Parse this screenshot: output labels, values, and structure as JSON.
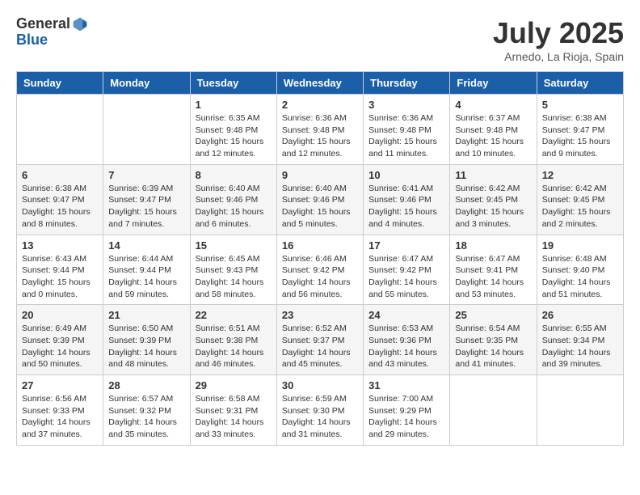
{
  "logo": {
    "general": "General",
    "blue": "Blue"
  },
  "title": "July 2025",
  "location": "Arnedo, La Rioja, Spain",
  "weekdays": [
    "Sunday",
    "Monday",
    "Tuesday",
    "Wednesday",
    "Thursday",
    "Friday",
    "Saturday"
  ],
  "weeks": [
    [
      {
        "day": "",
        "info": ""
      },
      {
        "day": "",
        "info": ""
      },
      {
        "day": "1",
        "info": "Sunrise: 6:35 AM\nSunset: 9:48 PM\nDaylight: 15 hours and 12 minutes."
      },
      {
        "day": "2",
        "info": "Sunrise: 6:36 AM\nSunset: 9:48 PM\nDaylight: 15 hours and 12 minutes."
      },
      {
        "day": "3",
        "info": "Sunrise: 6:36 AM\nSunset: 9:48 PM\nDaylight: 15 hours and 11 minutes."
      },
      {
        "day": "4",
        "info": "Sunrise: 6:37 AM\nSunset: 9:48 PM\nDaylight: 15 hours and 10 minutes."
      },
      {
        "day": "5",
        "info": "Sunrise: 6:38 AM\nSunset: 9:47 PM\nDaylight: 15 hours and 9 minutes."
      }
    ],
    [
      {
        "day": "6",
        "info": "Sunrise: 6:38 AM\nSunset: 9:47 PM\nDaylight: 15 hours and 8 minutes."
      },
      {
        "day": "7",
        "info": "Sunrise: 6:39 AM\nSunset: 9:47 PM\nDaylight: 15 hours and 7 minutes."
      },
      {
        "day": "8",
        "info": "Sunrise: 6:40 AM\nSunset: 9:46 PM\nDaylight: 15 hours and 6 minutes."
      },
      {
        "day": "9",
        "info": "Sunrise: 6:40 AM\nSunset: 9:46 PM\nDaylight: 15 hours and 5 minutes."
      },
      {
        "day": "10",
        "info": "Sunrise: 6:41 AM\nSunset: 9:46 PM\nDaylight: 15 hours and 4 minutes."
      },
      {
        "day": "11",
        "info": "Sunrise: 6:42 AM\nSunset: 9:45 PM\nDaylight: 15 hours and 3 minutes."
      },
      {
        "day": "12",
        "info": "Sunrise: 6:42 AM\nSunset: 9:45 PM\nDaylight: 15 hours and 2 minutes."
      }
    ],
    [
      {
        "day": "13",
        "info": "Sunrise: 6:43 AM\nSunset: 9:44 PM\nDaylight: 15 hours and 0 minutes."
      },
      {
        "day": "14",
        "info": "Sunrise: 6:44 AM\nSunset: 9:44 PM\nDaylight: 14 hours and 59 minutes."
      },
      {
        "day": "15",
        "info": "Sunrise: 6:45 AM\nSunset: 9:43 PM\nDaylight: 14 hours and 58 minutes."
      },
      {
        "day": "16",
        "info": "Sunrise: 6:46 AM\nSunset: 9:42 PM\nDaylight: 14 hours and 56 minutes."
      },
      {
        "day": "17",
        "info": "Sunrise: 6:47 AM\nSunset: 9:42 PM\nDaylight: 14 hours and 55 minutes."
      },
      {
        "day": "18",
        "info": "Sunrise: 6:47 AM\nSunset: 9:41 PM\nDaylight: 14 hours and 53 minutes."
      },
      {
        "day": "19",
        "info": "Sunrise: 6:48 AM\nSunset: 9:40 PM\nDaylight: 14 hours and 51 minutes."
      }
    ],
    [
      {
        "day": "20",
        "info": "Sunrise: 6:49 AM\nSunset: 9:39 PM\nDaylight: 14 hours and 50 minutes."
      },
      {
        "day": "21",
        "info": "Sunrise: 6:50 AM\nSunset: 9:39 PM\nDaylight: 14 hours and 48 minutes."
      },
      {
        "day": "22",
        "info": "Sunrise: 6:51 AM\nSunset: 9:38 PM\nDaylight: 14 hours and 46 minutes."
      },
      {
        "day": "23",
        "info": "Sunrise: 6:52 AM\nSunset: 9:37 PM\nDaylight: 14 hours and 45 minutes."
      },
      {
        "day": "24",
        "info": "Sunrise: 6:53 AM\nSunset: 9:36 PM\nDaylight: 14 hours and 43 minutes."
      },
      {
        "day": "25",
        "info": "Sunrise: 6:54 AM\nSunset: 9:35 PM\nDaylight: 14 hours and 41 minutes."
      },
      {
        "day": "26",
        "info": "Sunrise: 6:55 AM\nSunset: 9:34 PM\nDaylight: 14 hours and 39 minutes."
      }
    ],
    [
      {
        "day": "27",
        "info": "Sunrise: 6:56 AM\nSunset: 9:33 PM\nDaylight: 14 hours and 37 minutes."
      },
      {
        "day": "28",
        "info": "Sunrise: 6:57 AM\nSunset: 9:32 PM\nDaylight: 14 hours and 35 minutes."
      },
      {
        "day": "29",
        "info": "Sunrise: 6:58 AM\nSunset: 9:31 PM\nDaylight: 14 hours and 33 minutes."
      },
      {
        "day": "30",
        "info": "Sunrise: 6:59 AM\nSunset: 9:30 PM\nDaylight: 14 hours and 31 minutes."
      },
      {
        "day": "31",
        "info": "Sunrise: 7:00 AM\nSunset: 9:29 PM\nDaylight: 14 hours and 29 minutes."
      },
      {
        "day": "",
        "info": ""
      },
      {
        "day": "",
        "info": ""
      }
    ]
  ]
}
